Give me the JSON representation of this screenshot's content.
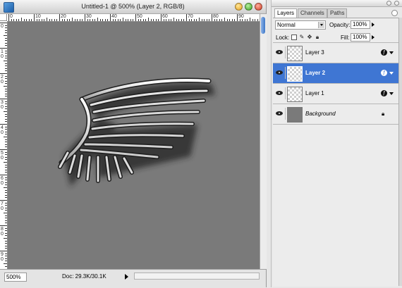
{
  "document": {
    "title": "Untitled-1 @ 500% (Layer 2, RGB/8)",
    "ruler_top_labels": [
      "0",
      "10",
      "20",
      "30",
      "40",
      "50",
      "60",
      "70",
      "80",
      "90"
    ],
    "ruler_left_labels": [
      "0",
      "1\n0",
      "2\n0",
      "3\n0",
      "4\n0",
      "5\n0",
      "6\n0",
      "7\n0",
      "8\n0",
      "9\n0"
    ],
    "canvas_bg": "#7a7a7a",
    "artwork_icon": "wing-artwork"
  },
  "status": {
    "zoom": "500%",
    "doc_info": "Doc: 29.3K/30.1K"
  },
  "panel": {
    "tabs": [
      "Layers",
      "Channels",
      "Paths"
    ],
    "active_tab": "Layers",
    "blend_mode": "Normal",
    "opacity_label": "Opacity:",
    "opacity_value": "100%",
    "lock_label": "Lock:",
    "fill_label": "Fill:",
    "fill_value": "100%",
    "layers": [
      {
        "name": "Layer 3",
        "selected": false,
        "fx": true
      },
      {
        "name": "Layer 2",
        "selected": true,
        "fx": true
      },
      {
        "name": "Layer 1",
        "selected": false,
        "fx": true
      },
      {
        "name": "Background",
        "selected": false,
        "fx": false,
        "locked": true
      }
    ],
    "selection_color": "#3f76d3"
  }
}
